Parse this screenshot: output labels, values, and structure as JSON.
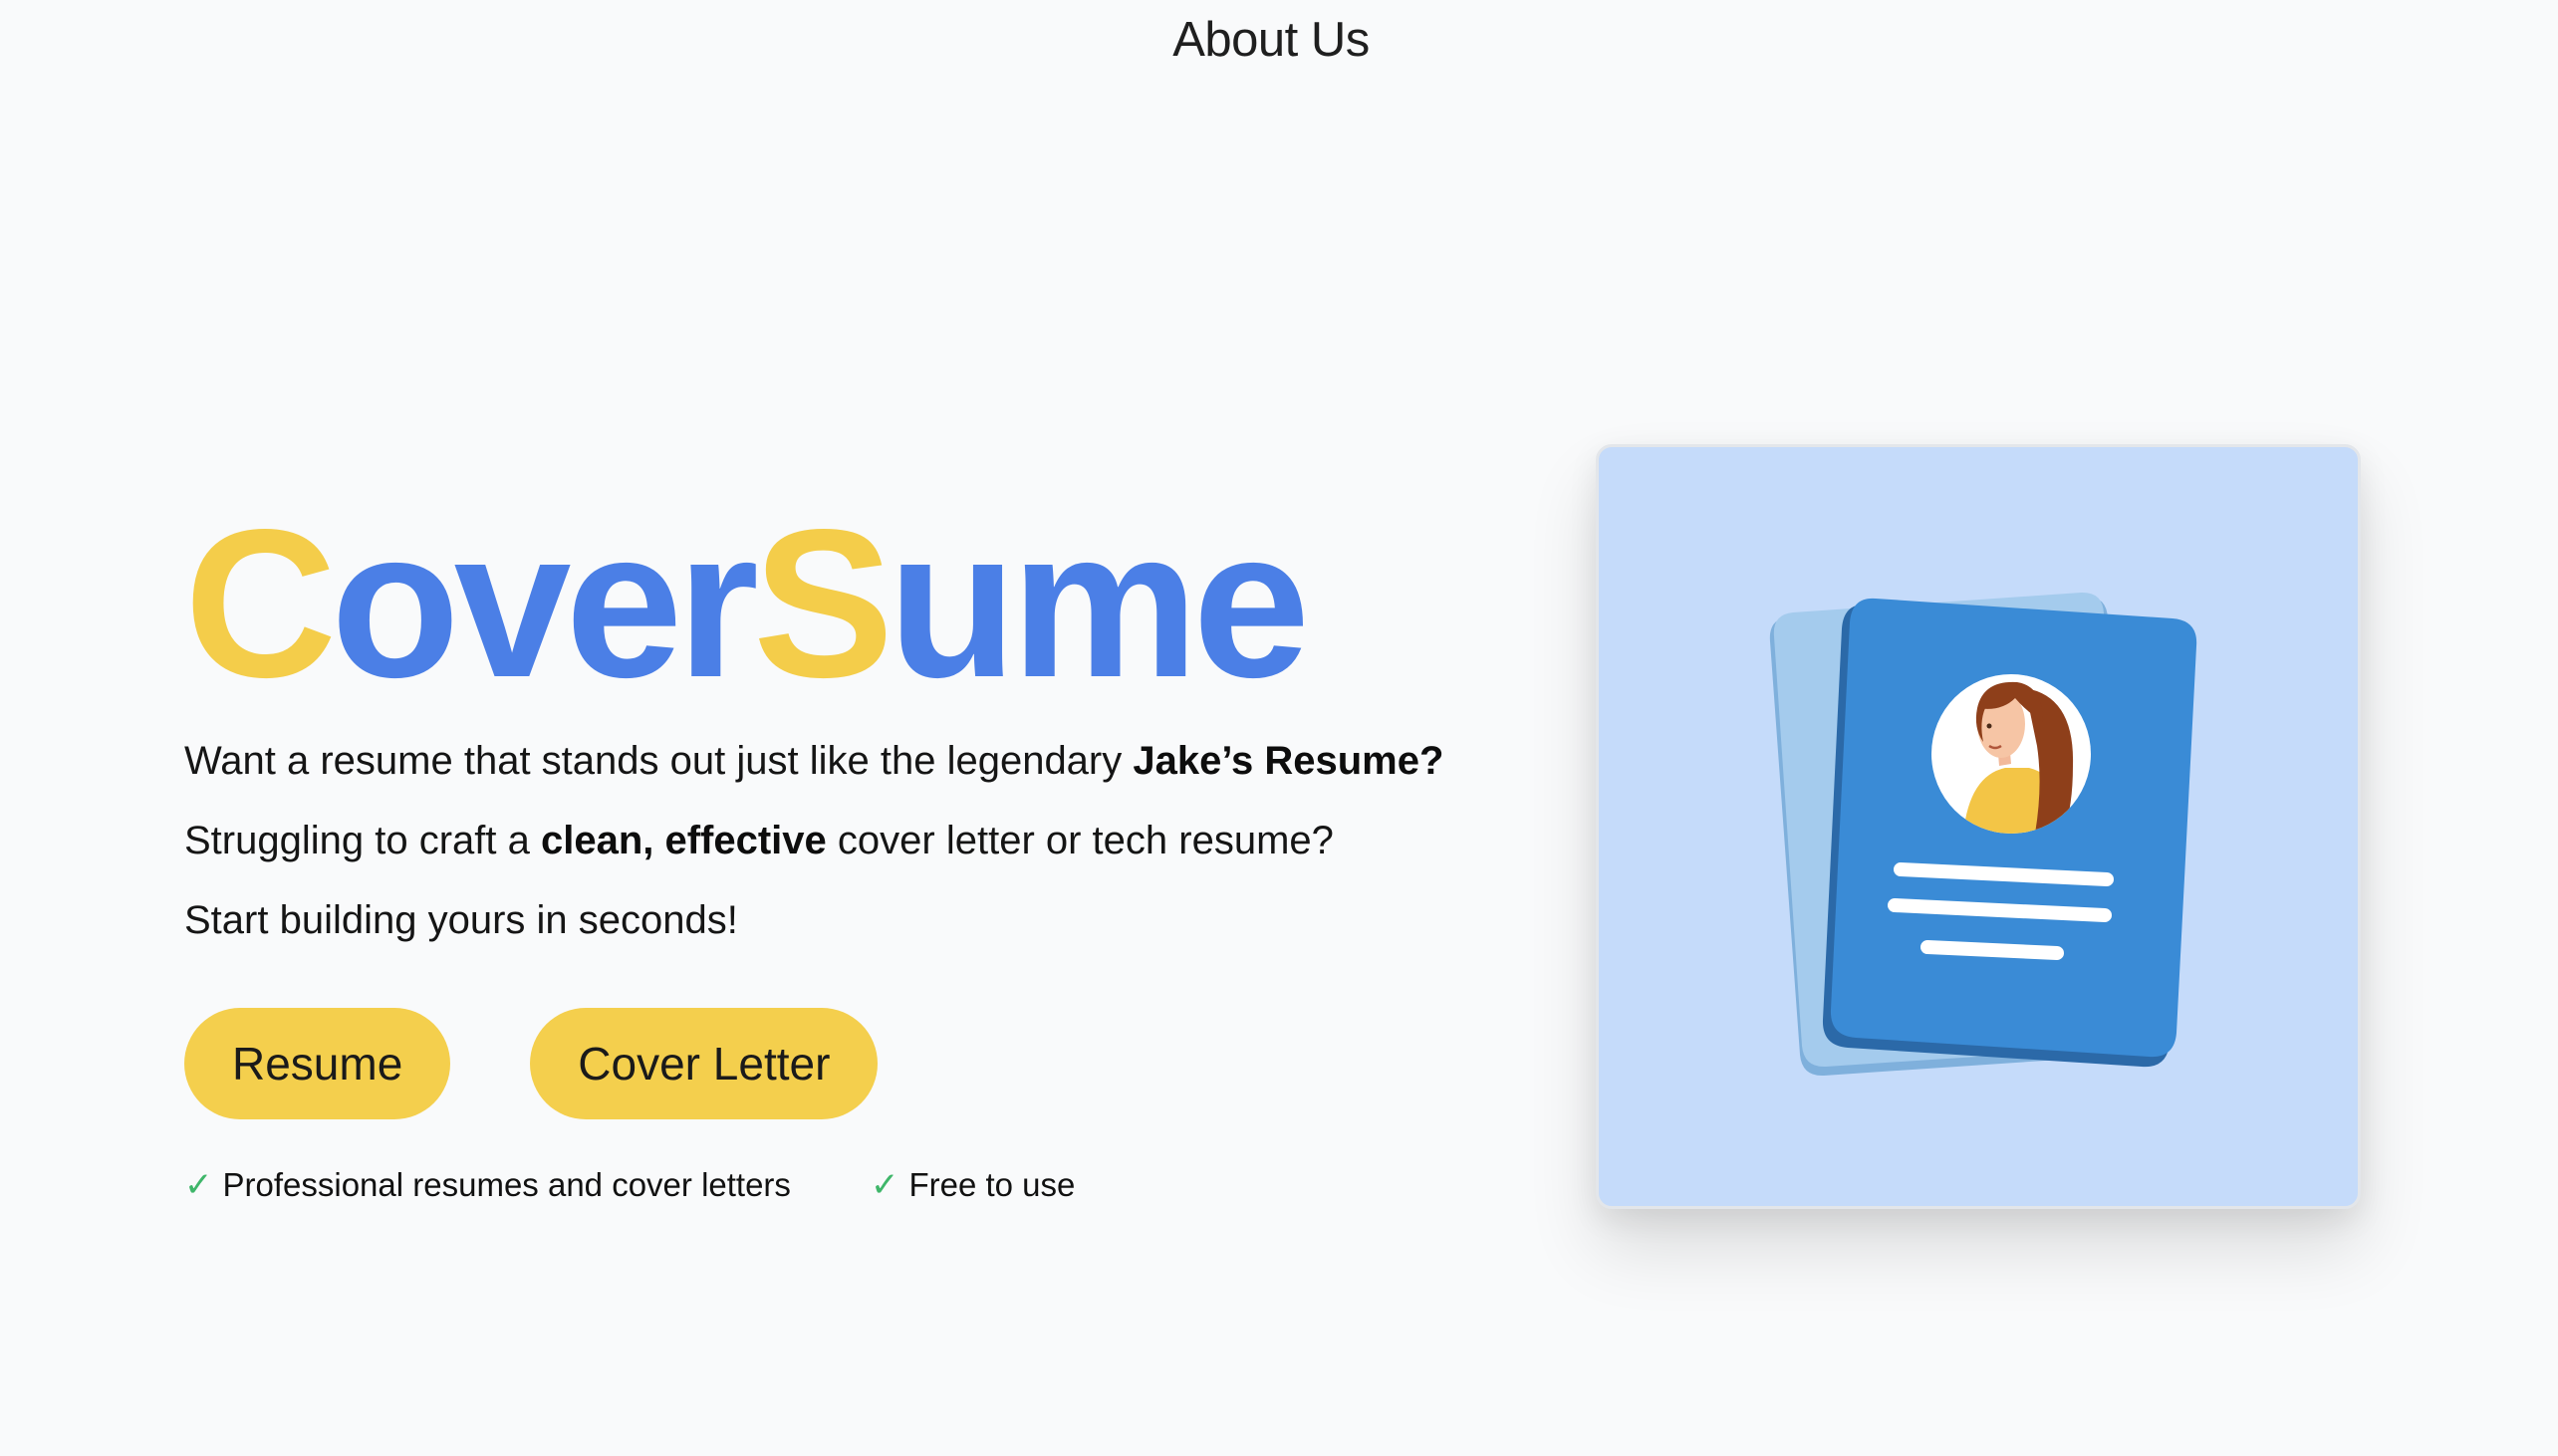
{
  "nav": {
    "about_label": "About Us"
  },
  "hero": {
    "logo": {
      "part1_initial": "C",
      "part1_rest": "over",
      "part2_initial": "S",
      "part2_rest": "ume"
    },
    "line1_prefix": "Want a resume that stands out just like the legendary ",
    "line1_bold": "Jake’s Resume?",
    "line2_prefix": "Struggling to craft a ",
    "line2_bold": "clean, effective",
    "line2_suffix": " cover letter or tech resume?",
    "line3": "Start building yours in seconds!",
    "buttons": {
      "resume_label": "Resume",
      "cover_letter_label": "Cover Letter"
    },
    "features": [
      {
        "check": "✓",
        "label": "Professional resumes and cover letters"
      },
      {
        "check": "✓",
        "label": "Free to use"
      }
    ]
  },
  "illustration": {
    "icon": "resume-document-illustration"
  },
  "colors": {
    "logo_yellow": "#f4cd4a",
    "logo_blue": "#4b7fe6",
    "button_yellow": "#f4cf4d",
    "check_green": "#3fb66a",
    "card_background": "#c5dbfa",
    "document_blue": "#3b8ad6"
  }
}
